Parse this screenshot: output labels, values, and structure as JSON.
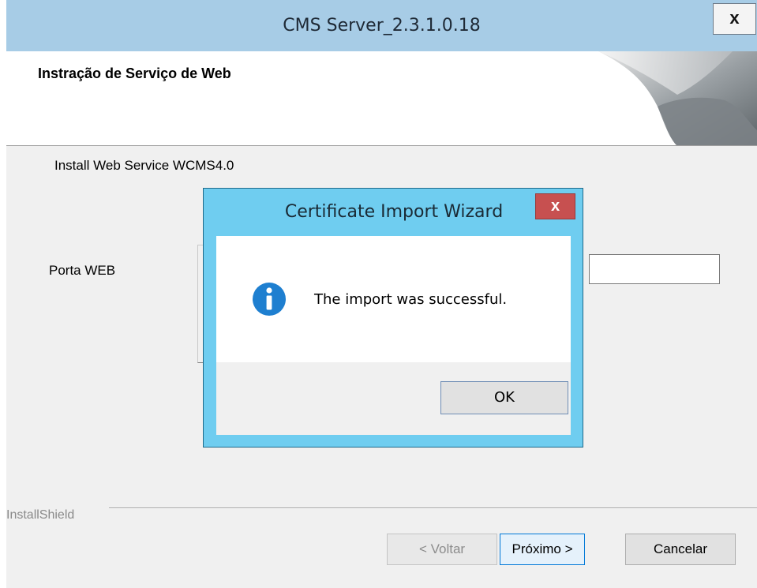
{
  "window": {
    "title": "CMS Server_2.3.1.0.18",
    "close_label": "x"
  },
  "header": {
    "heading": "Instração de Serviço de Web"
  },
  "body": {
    "description": "Install Web Service WCMS4.0",
    "port_label": "Porta WEB",
    "port_value": ""
  },
  "footer": {
    "brand": "InstallShield",
    "back_label": "< Voltar",
    "next_label": "Próximo >",
    "cancel_label": "Cancelar"
  },
  "dialog": {
    "title": "Certificate Import Wizard",
    "close_label": "x",
    "message": "The import was successful.",
    "ok_label": "OK",
    "icon": "info-icon"
  },
  "colors": {
    "main_titlebar": "#a7cce6",
    "dialog_frame": "#6fcdf0",
    "dialog_close": "#c75050",
    "info_icon": "#1e7fd0"
  }
}
